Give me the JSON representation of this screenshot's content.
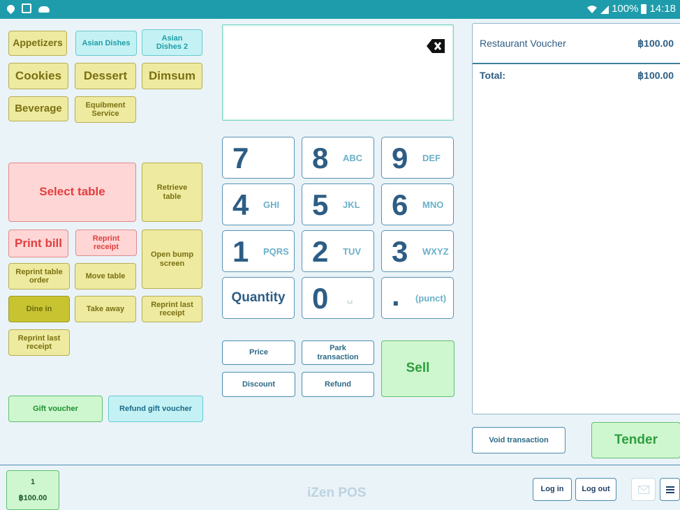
{
  "status_bar": {
    "battery": "100%",
    "time": "14:18"
  },
  "categories": [
    {
      "label": "Appetizers"
    },
    {
      "label": "Asian Dishes"
    },
    {
      "label": "Asian Dishes 2"
    },
    {
      "label": "Cookies"
    },
    {
      "label": "Dessert"
    },
    {
      "label": "Dimsum"
    },
    {
      "label": "Beverage"
    },
    {
      "label": "Equibment Service"
    }
  ],
  "actions": {
    "select_table": "Select table",
    "retrieve_table": "Retrieve table",
    "print_bill": "Print bill",
    "reprint_receipt": "Reprint receipt",
    "open_bump_screen": "Open bump screen",
    "reprint_table_order": "Reprint table order",
    "move_table": "Move table",
    "dine_in": "Dine in",
    "take_away": "Take away",
    "reprint_last_receipt": "Reprint last receipt",
    "reprint_last_receipt_2": "Reprint last receipt",
    "gift_voucher": "Gift voucher",
    "refund_gift_voucher": "Refund gift voucher"
  },
  "keypad": {
    "keys": [
      {
        "num": "7",
        "sub": ""
      },
      {
        "num": "8",
        "sub": "ABC"
      },
      {
        "num": "9",
        "sub": "DEF"
      },
      {
        "num": "4",
        "sub": "GHI"
      },
      {
        "num": "5",
        "sub": "JKL"
      },
      {
        "num": "6",
        "sub": "MNO"
      },
      {
        "num": "1",
        "sub": "PQRS"
      },
      {
        "num": "2",
        "sub": "TUV"
      },
      {
        "num": "3",
        "sub": "WXYZ"
      }
    ],
    "quantity": "Quantity",
    "zero": "0",
    "zero_sub": "␣",
    "dot": ".",
    "dot_sub": "(punct)"
  },
  "functions": {
    "price": "Price",
    "park_transaction": "Park transaction",
    "sell": "Sell",
    "discount": "Discount",
    "refund": "Refund"
  },
  "receipt": {
    "item_name": "Restaurant Voucher",
    "item_amount": "฿100.00",
    "total_label": "Total:",
    "total_amount": "฿100.00"
  },
  "receipt_actions": {
    "void_transaction": "Void transaction",
    "tender": "Tender"
  },
  "bottom": {
    "tab_number": "1",
    "tab_amount": "฿100.00",
    "brand": "iZen POS",
    "log_in": "Log in",
    "log_out": "Log out"
  }
}
